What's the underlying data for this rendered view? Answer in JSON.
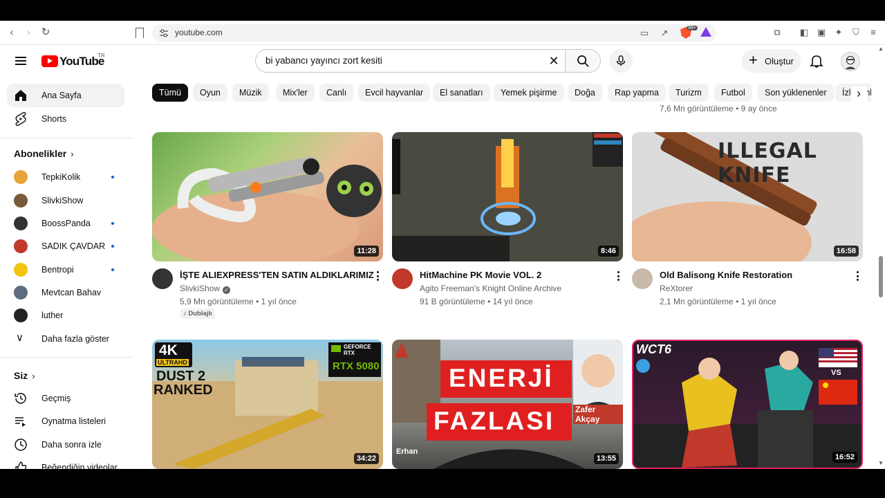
{
  "browser": {
    "url": "youtube.com",
    "badge": "99+"
  },
  "header": {
    "logo_text": "YouTube",
    "country": "TR",
    "search_value": "bi yabancı yayıncı zort kesiti",
    "create_label": "Oluştur"
  },
  "sidebar": {
    "home": "Ana Sayfa",
    "shorts": "Shorts",
    "subscriptions_title": "Abonelikler",
    "subscriptions": [
      {
        "name": "TepkiKolik",
        "live": true,
        "color": "#e8a33a"
      },
      {
        "name": "SlivkiShow",
        "live": false,
        "color": "#7a5a3a"
      },
      {
        "name": "BoossPanda",
        "live": true,
        "color": "#333333"
      },
      {
        "name": "SADIK ÇAVDAR",
        "live": true,
        "color": "#c0392b"
      },
      {
        "name": "Bentropi",
        "live": true,
        "color": "#f1c40f"
      },
      {
        "name": "Mevtcan Bahav",
        "live": false,
        "color": "#5d6d7e"
      },
      {
        "name": "luther",
        "live": false,
        "color": "#222222"
      }
    ],
    "show_more": "Daha fazla göster",
    "you_title": "Siz",
    "you_items": [
      "Geçmiş",
      "Oynatma listeleri",
      "Daha sonra izle",
      "Beğendiğin videolar"
    ]
  },
  "chips": [
    "Tümü",
    "Oyun",
    "Müzik",
    "Mix'ler",
    "Canlı",
    "Evcil hayvanlar",
    "El sanatları",
    "Yemek pişirme",
    "Doğa",
    "Rap yapma",
    "Turizm",
    "Futbol",
    "Son yüklenenler",
    "İzlenenler"
  ],
  "peek_meta": "7,6 Mn görüntüleme • 9 ay önce",
  "videos": [
    {
      "title": "İŞTE ALIEXPRESS'TEN SATIN ALDIKLARIMIZ",
      "channel": "SlivkiShow",
      "verified": true,
      "meta": "5,9 Mn görüntüleme • 1 yıl önce",
      "badge": "Dublajlı",
      "duration": "11:28"
    },
    {
      "title": "HitMachine PK Movie VOL. 2",
      "channel": "Agito Freeman's Knight Online Archive",
      "verified": false,
      "meta": "91 B görüntüleme • 14 yıl önce",
      "duration": "8:46"
    },
    {
      "title": "Old Balisong Knife Restoration",
      "channel": "ReXtorer",
      "verified": false,
      "meta": "2,1 Mn görüntüleme • 1 yıl önce",
      "duration": "16:58",
      "thumb_text": "ILLEGAL KNIFE"
    },
    {
      "duration": "34:22",
      "thumb_text_a": "4K",
      "thumb_text_b": "ULTRAHD",
      "thumb_text_c": "DUST 2",
      "thumb_text_d": "RANKED",
      "thumb_text_e": "GEFORCE RTX",
      "thumb_text_f": "RTX 5080"
    },
    {
      "duration": "13:55",
      "thumb_text_a": "ENERJİ",
      "thumb_text_b": "FAZLASI",
      "thumb_text_c": "Zafer Akçay",
      "thumb_text_d": "Erhan"
    },
    {
      "duration": "16:52",
      "thumb_text_a": "WCT6",
      "thumb_text_b": "VS"
    }
  ]
}
